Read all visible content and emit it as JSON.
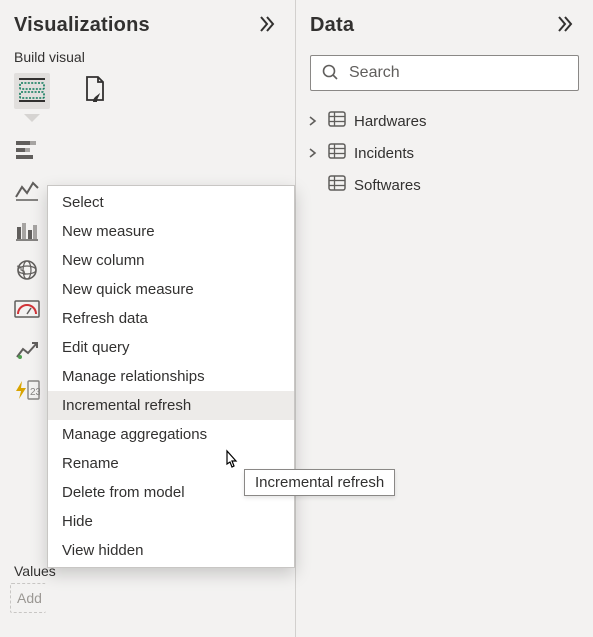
{
  "visualizations": {
    "pane_title": "Visualizations",
    "sub_label": "Build visual",
    "values_label": "Values",
    "add_fields_placeholder": "Add data fields here"
  },
  "data": {
    "pane_title": "Data",
    "search_placeholder": "Search",
    "tables": [
      {
        "label": "Hardwares",
        "expandable": true
      },
      {
        "label": "Incidents",
        "expandable": true
      },
      {
        "label": "Softwares",
        "expandable": false
      }
    ]
  },
  "context_menu": {
    "items": [
      "Select",
      "New measure",
      "New column",
      "New quick measure",
      "Refresh data",
      "Edit query",
      "Manage relationships",
      "Incremental refresh",
      "Manage aggregations",
      "Rename",
      "Delete from model",
      "Hide",
      "View hidden"
    ],
    "hovered_index": 7,
    "tooltip": "Incremental refresh"
  }
}
